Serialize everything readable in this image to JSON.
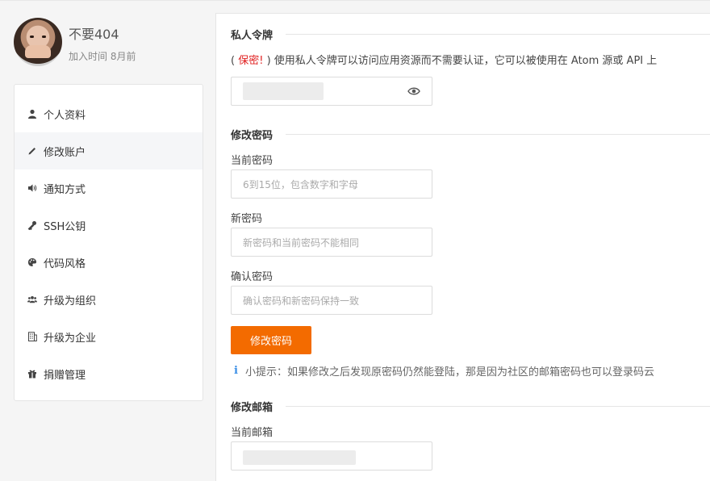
{
  "profile": {
    "username": "不要404",
    "joined": "加入时间 8月前"
  },
  "sidebar": {
    "items": [
      {
        "label": "个人资料",
        "icon": "user-icon"
      },
      {
        "label": "修改账户",
        "icon": "pencil-icon",
        "active": true
      },
      {
        "label": "通知方式",
        "icon": "speaker-icon"
      },
      {
        "label": "SSH公钥",
        "icon": "key-icon"
      },
      {
        "label": "代码风格",
        "icon": "palette-icon"
      },
      {
        "label": "升级为组织",
        "icon": "group-icon"
      },
      {
        "label": "升级为企业",
        "icon": "building-icon"
      },
      {
        "label": "捐赠管理",
        "icon": "gift-icon"
      }
    ]
  },
  "token": {
    "title": "私人令牌",
    "desc_open": "(",
    "desc_secret": "保密!",
    "desc_rest": ") 使用私人令牌可以访问应用资源而不需要认证，它可以被使用在 Atom 源或 API 上"
  },
  "password": {
    "title": "修改密码",
    "current_label": "当前密码",
    "current_placeholder": "6到15位，包含数字和字母",
    "new_label": "新密码",
    "new_placeholder": "新密码和当前密码不能相同",
    "confirm_label": "确认密码",
    "confirm_placeholder": "确认密码和新密码保持一致",
    "submit_label": "修改密码",
    "tip_icon": "i",
    "tip": "小提示：如果修改之后发现原密码仍然能登陆，那是因为社区的邮箱密码也可以登录码云"
  },
  "email": {
    "title": "修改邮箱",
    "current_label": "当前邮箱"
  },
  "colors": {
    "accent": "#f36b00",
    "secret": "#e02020",
    "info": "#3a8ee6"
  }
}
